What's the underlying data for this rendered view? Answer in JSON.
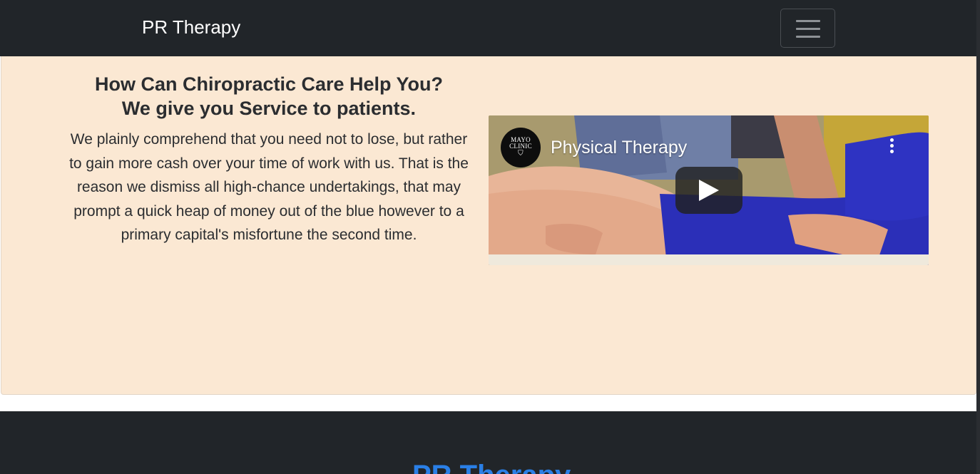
{
  "navbar": {
    "brand": "PR Therapy",
    "toggler_icon": "hamburger-icon"
  },
  "hero": {
    "heading_line1": "How Can Chiropractic Care Help You?",
    "heading_line2": "We give you Service to patients.",
    "paragraph": "We plainly comprehend that you need not to lose, but rather to gain more cash over your time of work with us. That is the reason we dismiss all high-chance undertakings, that may prompt a quick heap of money out of the blue however to a primary capital's misfortune the second time.",
    "background_color": "#fbe8d3"
  },
  "video": {
    "channel_logo_line1": "MAYO",
    "channel_logo_line2": "CLINIC",
    "title": "Physical Therapy",
    "menu_icon": "more-vert-icon",
    "play_icon": "play-icon"
  },
  "footer": {
    "brand": "PR Therapy",
    "brand_color": "#2a7fe6"
  }
}
